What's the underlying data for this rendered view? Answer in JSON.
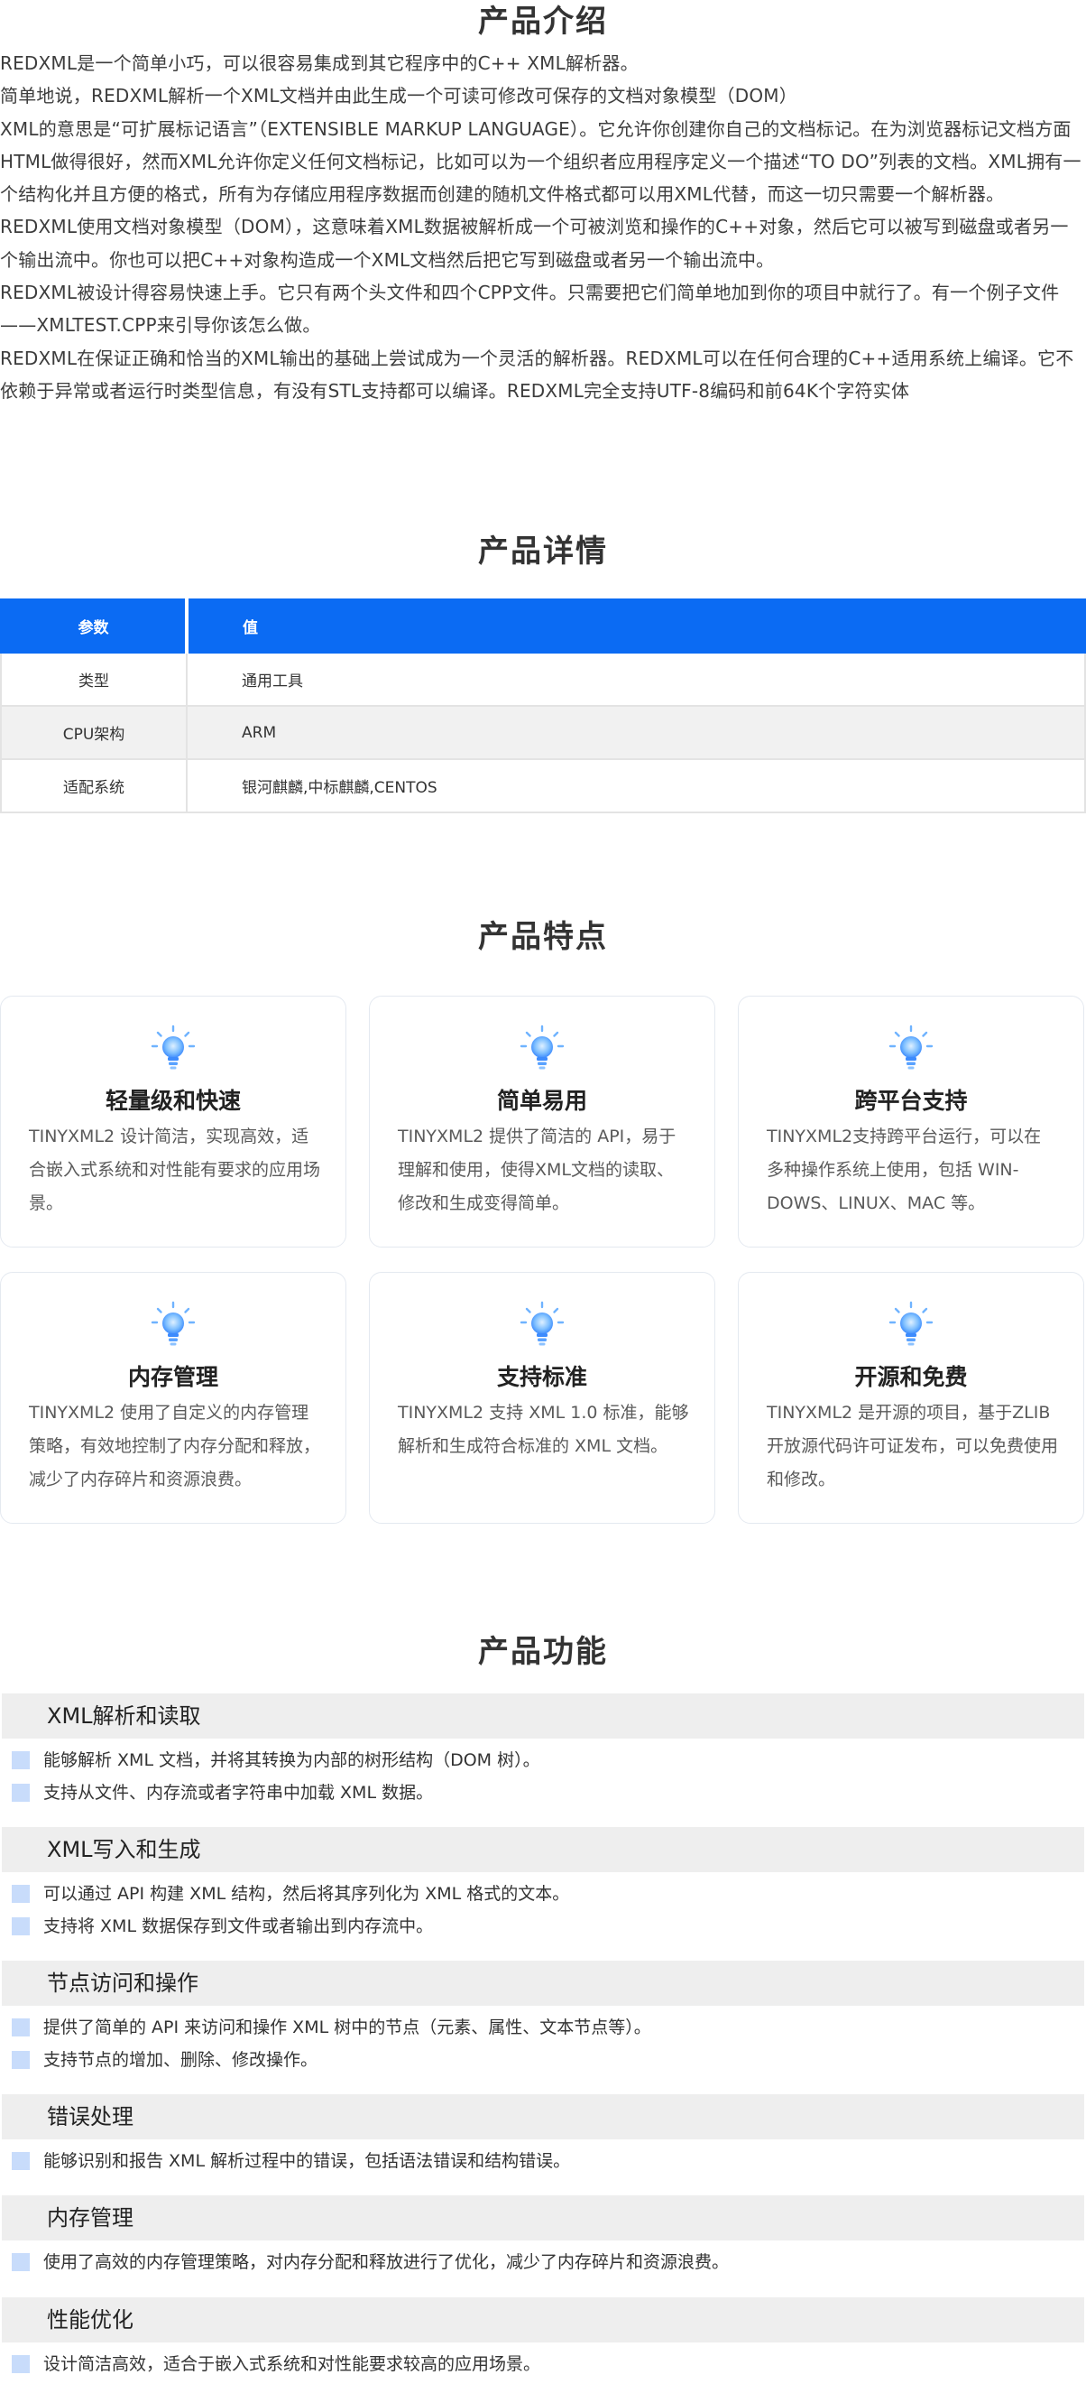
{
  "intro": {
    "title": "产品介绍",
    "paragraphs": [
      "REDXML是一个简单小巧，可以很容易集成到其它程序中的C++ XML解析器。",
      "简单地说，REDXML解析一个XML文档并由此生成一个可读可修改可保存的文档对象模型（DOM）",
      "XML的意思是“可扩展标记语言”（EXTENSIBLE MARKUP LANGUAGE）。它允许你创建你自己的文档标记。在为浏览器标记文档方面HTML做得很好，然而XML允许你定义任何文档标记，比如可以为一个组织者应用程序定义一个描述“TO DO”列表的文档。XML拥有一个结构化并且方便的格式，所有为存储应用程序数据而创建的随机文件格式都可以用XML代替，而这一切只需要一个解析器。",
      "REDXML使用文档对象模型（DOM），这意味着XML数据被解析成一个可被浏览和操作的C++对象，然后它可以被写到磁盘或者另一个输出流中。你也可以把C++对象构造成一个XML文档然后把它写到磁盘或者另一个输出流中。",
      "REDXML被设计得容易快速上手。它只有两个头文件和四个CPP文件。只需要把它们简单地加到你的项目中就行了。有一个例子文件——XMLTEST.CPP来引导你该怎么做。",
      "REDXML在保证正确和恰当的XML输出的基础上尝试成为一个灵活的解析器。REDXML可以在任何合理的C++适用系统上编译。它不依赖于异常或者运行时类型信息，有没有STL支持都可以编译。REDXML完全支持UTF-8编码和前64K个字符实体"
    ]
  },
  "details": {
    "title": "产品详情",
    "headers": [
      "参数",
      "值"
    ],
    "rows": [
      [
        "类型",
        "通用工具"
      ],
      [
        "CPU架构",
        "ARM"
      ],
      [
        "适配系统",
        "银河麒麟,中标麒麟,CENTOS"
      ]
    ]
  },
  "features": {
    "title": "产品特点",
    "icon": "lightbulb-icon",
    "accent": "#3d8bfd",
    "cards": [
      {
        "title": "轻量级和快速",
        "desc": "TINYXML2 设计简洁，实现高效，适合嵌入式系统和对性能有要求的应用场景。"
      },
      {
        "title": "简单易用",
        "desc": "TINYXML2 提供了简洁的 API，易于理解和使用，使得XML文档的读取、修改和生成变得简单。"
      },
      {
        "title": "跨平台支持",
        "desc": "TINYXML2支持跨平台运行，可以在多种操作系统上使用，包括 WIN-DOWS、LINUX、MAC 等。"
      },
      {
        "title": "内存管理",
        "desc": "TINYXML2 使用了自定义的内存管理策略，有效地控制了内存分配和释放，减少了内存碎片和资源浪费。"
      },
      {
        "title": "支持标准",
        "desc": "TINYXML2 支持 XML 1.0 标准，能够解析和生成符合标准的 XML 文档。"
      },
      {
        "title": "开源和免费",
        "desc": "TINYXML2 是开源的项目，基于ZLIB 开放源代码许可证发布，可以免费使用和修改。"
      }
    ]
  },
  "functions": {
    "title": "产品功能",
    "groups": [
      {
        "header": "XML解析和读取",
        "items": [
          "能够解析 XML 文档，并将其转换为内部的树形结构（DOM 树）。",
          "支持从文件、内存流或者字符串中加载 XML 数据。"
        ]
      },
      {
        "header": "XML写入和生成",
        "items": [
          "可以通过 API 构建 XML 结构，然后将其序列化为 XML 格式的文本。",
          "支持将 XML 数据保存到文件或者输出到内存流中。"
        ]
      },
      {
        "header": "节点访问和操作",
        "items": [
          "提供了简单的 API 来访问和操作 XML 树中的节点（元素、属性、文本节点等）。",
          "支持节点的增加、删除、修改操作。"
        ]
      },
      {
        "header": "错误处理",
        "items": [
          "能够识别和报告 XML 解析过程中的错误，包括语法错误和结构错误。"
        ]
      },
      {
        "header": "内存管理",
        "items": [
          "使用了高效的内存管理策略，对内存分配和释放进行了优化，减少了内存碎片和资源浪费。"
        ]
      },
      {
        "header": "性能优化",
        "items": [
          "设计简洁高效，适合于嵌入式系统和对性能要求较高的应用场景。"
        ]
      }
    ]
  }
}
